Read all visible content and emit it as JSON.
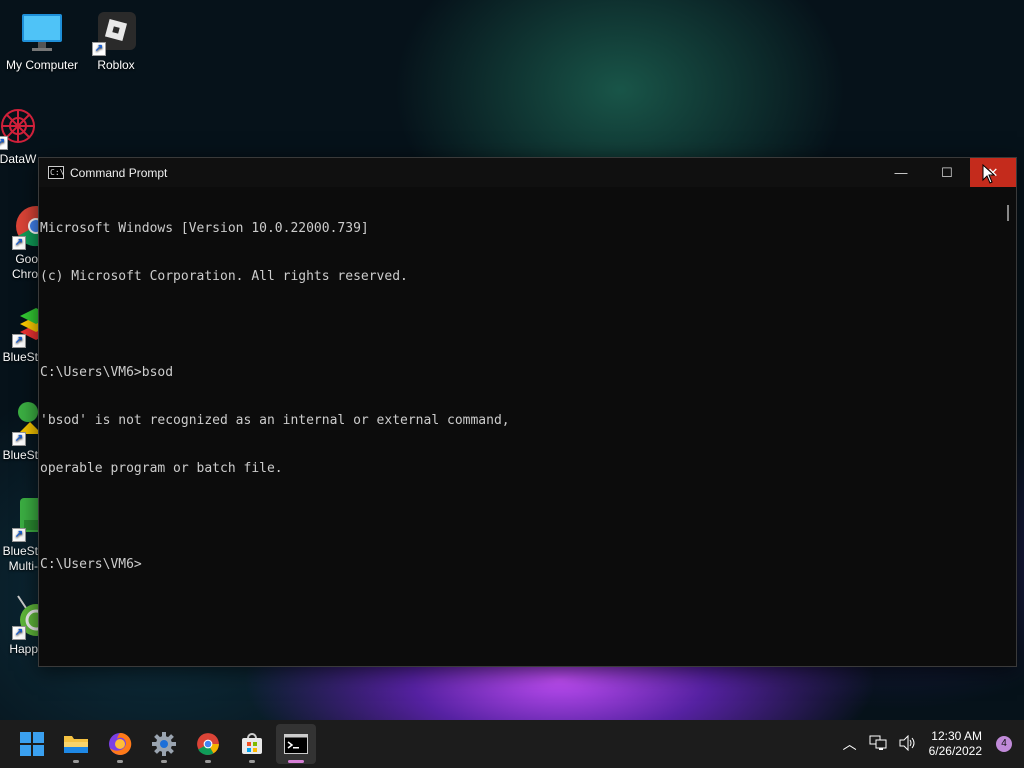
{
  "desktop": {
    "icons": [
      {
        "label": "My Computer"
      },
      {
        "label": "Roblox"
      },
      {
        "label": "DataW"
      },
      {
        "label": "Goo Chro"
      },
      {
        "label": "BlueSt"
      },
      {
        "label": "BlueSt"
      },
      {
        "label": "BlueSt Multi-"
      },
      {
        "label": "Happ"
      }
    ]
  },
  "window": {
    "title": "Command Prompt",
    "minimize": "—",
    "maximize": "☐",
    "close": "✕",
    "icon_text": "C:\\"
  },
  "console": {
    "lines": [
      "Microsoft Windows [Version 10.0.22000.739]",
      "(c) Microsoft Corporation. All rights reserved.",
      "",
      "C:\\Users\\VM6>bsod",
      "'bsod' is not recognized as an internal or external command,",
      "operable program or batch file.",
      "",
      "C:\\Users\\VM6>"
    ]
  },
  "taskbar": {
    "apps": [
      {
        "name": "start",
        "icon": "windows-logo-icon"
      },
      {
        "name": "file-explorer",
        "icon": "folder-icon"
      },
      {
        "name": "firefox",
        "icon": "firefox-icon"
      },
      {
        "name": "settings",
        "icon": "gear-icon"
      },
      {
        "name": "chrome",
        "icon": "chrome-icon"
      },
      {
        "name": "microsoft-store",
        "icon": "store-icon"
      },
      {
        "name": "command-prompt",
        "icon": "terminal-icon"
      }
    ],
    "tray": {
      "time": "12:30 AM",
      "date": "6/26/2022",
      "notification_count": "4"
    }
  },
  "colors": {
    "close_red": "#c42b1c",
    "console_bg": "#0c0c0c",
    "console_text": "#cccccc",
    "taskbar_bg": "#1c1c1c",
    "active_indicator": "#d67fd6"
  }
}
